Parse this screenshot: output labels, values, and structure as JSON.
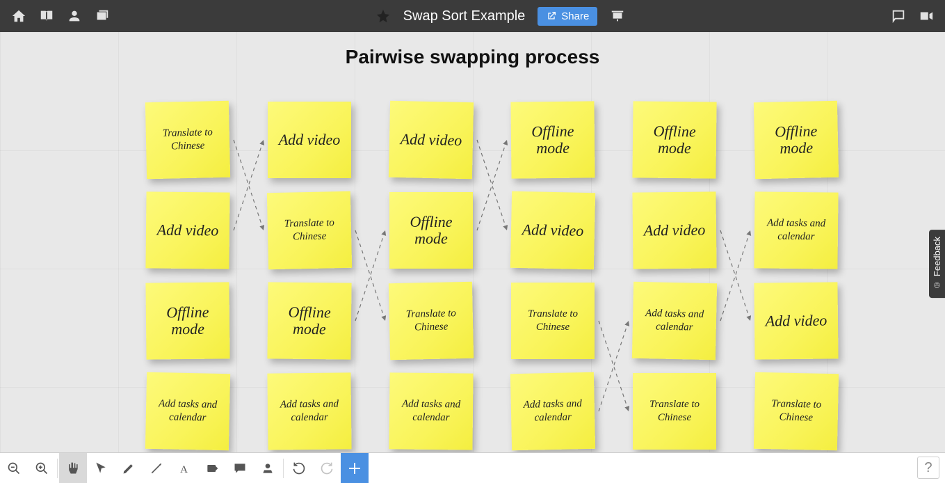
{
  "header": {
    "title": "Swap Sort Example",
    "share_label": "Share"
  },
  "canvas": {
    "title": "Pairwise swapping process"
  },
  "feedback": {
    "label": "Feedback"
  },
  "help": {
    "label": "?"
  },
  "note_texts": {
    "translate": "Translate to Chinese",
    "add_video": "Add video",
    "offline": "Offline mode",
    "tasks": "Add tasks and calendar"
  },
  "columns": [
    {
      "notes": [
        {
          "key": "translate",
          "size": "small"
        },
        {
          "key": "add_video",
          "size": "big"
        },
        {
          "key": "offline",
          "size": "big"
        },
        {
          "key": "tasks",
          "size": "small"
        }
      ]
    },
    {
      "notes": [
        {
          "key": "add_video",
          "size": "big"
        },
        {
          "key": "translate",
          "size": "small"
        },
        {
          "key": "offline",
          "size": "big"
        },
        {
          "key": "tasks",
          "size": "small"
        }
      ]
    },
    {
      "notes": [
        {
          "key": "add_video",
          "size": "big"
        },
        {
          "key": "offline",
          "size": "big"
        },
        {
          "key": "translate",
          "size": "small"
        },
        {
          "key": "tasks",
          "size": "small"
        }
      ]
    },
    {
      "notes": [
        {
          "key": "offline",
          "size": "big"
        },
        {
          "key": "add_video",
          "size": "big"
        },
        {
          "key": "translate",
          "size": "small"
        },
        {
          "key": "tasks",
          "size": "small"
        }
      ]
    },
    {
      "notes": [
        {
          "key": "offline",
          "size": "big"
        },
        {
          "key": "add_video",
          "size": "big"
        },
        {
          "key": "tasks",
          "size": "small"
        },
        {
          "key": "translate",
          "size": "small"
        }
      ]
    },
    {
      "notes": [
        {
          "key": "offline",
          "size": "big"
        },
        {
          "key": "tasks",
          "size": "small"
        },
        {
          "key": "add_video",
          "size": "big"
        },
        {
          "key": "translate",
          "size": "small"
        }
      ]
    }
  ],
  "arrows": [
    {
      "from": [
        0,
        0
      ],
      "to": [
        1,
        1
      ]
    },
    {
      "from": [
        0,
        1
      ],
      "to": [
        1,
        0
      ]
    },
    {
      "from": [
        1,
        1
      ],
      "to": [
        2,
        2
      ]
    },
    {
      "from": [
        1,
        2
      ],
      "to": [
        2,
        1
      ]
    },
    {
      "from": [
        2,
        1
      ],
      "to": [
        3,
        0
      ]
    },
    {
      "from": [
        2,
        0
      ],
      "to": [
        3,
        1
      ]
    },
    {
      "from": [
        3,
        2
      ],
      "to": [
        4,
        3
      ]
    },
    {
      "from": [
        3,
        3
      ],
      "to": [
        4,
        2
      ]
    },
    {
      "from": [
        4,
        1
      ],
      "to": [
        5,
        2
      ]
    },
    {
      "from": [
        4,
        2
      ],
      "to": [
        5,
        1
      ]
    }
  ],
  "layout": {
    "col_x": [
      0,
      175,
      350,
      525,
      700,
      875
    ],
    "row_y": [
      0,
      130,
      260,
      390
    ],
    "note_w": 120,
    "note_h": 110
  }
}
